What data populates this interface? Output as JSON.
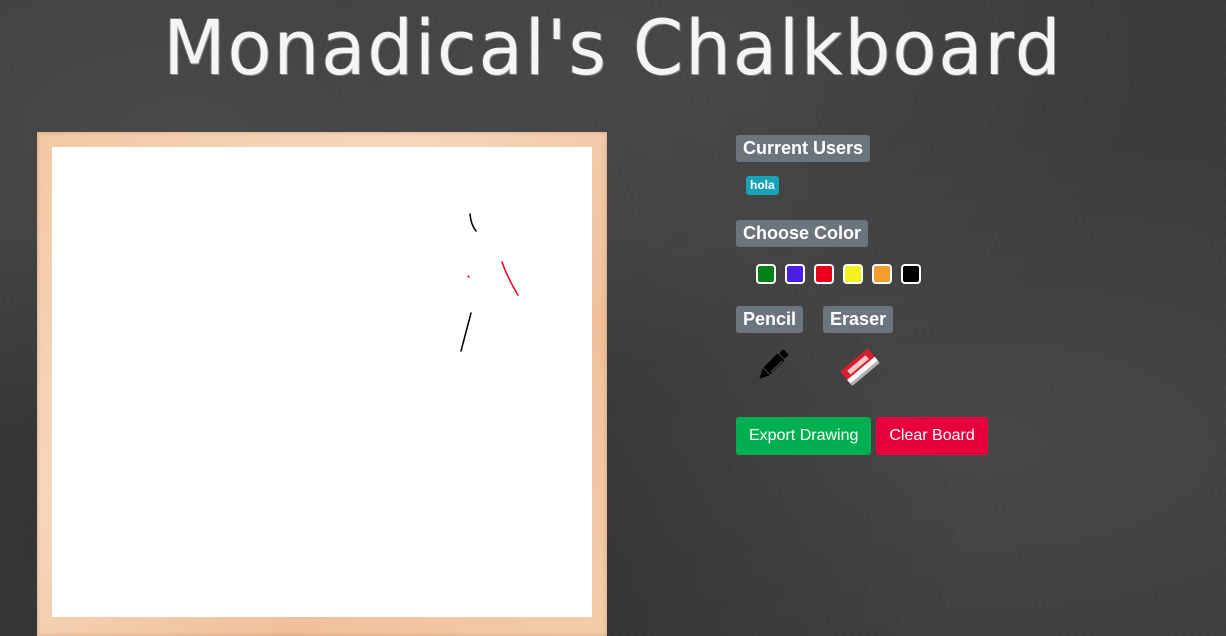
{
  "header": {
    "title": "Monadical's Chalkboard"
  },
  "users": {
    "heading": "Current Users",
    "list": [
      "hola"
    ],
    "badge_color": "#17a2b8"
  },
  "colors": {
    "heading": "Choose Color",
    "swatches": [
      {
        "name": "green",
        "hex": "#00801a"
      },
      {
        "name": "purple",
        "hex": "#4a1ee6"
      },
      {
        "name": "red",
        "hex": "#e8001c"
      },
      {
        "name": "yellow",
        "hex": "#f2f21f"
      },
      {
        "name": "orange",
        "hex": "#f59c2f"
      },
      {
        "name": "black",
        "hex": "#000000"
      }
    ]
  },
  "tools": {
    "pencil_label": "Pencil",
    "pencil_icon": "pencil-icon",
    "eraser_label": "Eraser",
    "eraser_icon": "eraser-icon"
  },
  "actions": {
    "export_label": "Export Drawing",
    "export_color": "#00b050",
    "clear_label": "Clear Board",
    "clear_color": "#e8003d"
  },
  "drawing": {
    "strokes": [
      {
        "color": "#000000"
      },
      {
        "color": "#e8001c"
      },
      {
        "color": "#e8001c"
      },
      {
        "color": "#000000"
      }
    ]
  }
}
